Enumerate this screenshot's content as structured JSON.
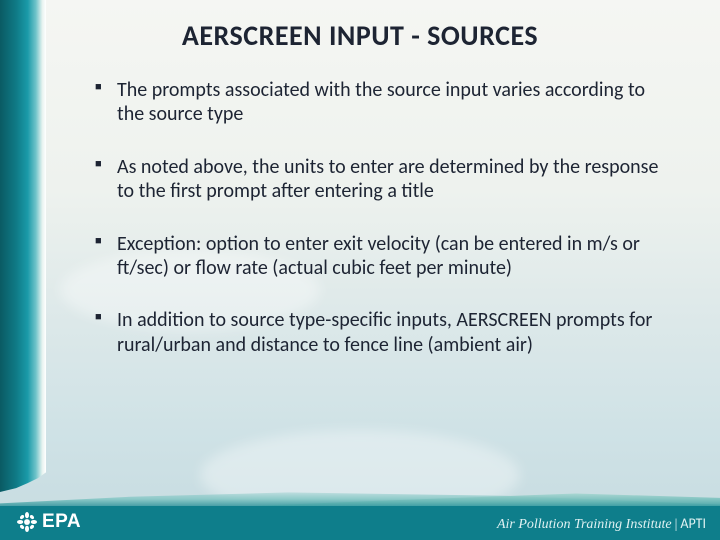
{
  "title": "AERSCREEN INPUT - SOURCES",
  "bullets": [
    "The prompts associated with the source input varies according to the source type",
    "As noted above, the units to enter are determined by the response to the first prompt after entering a title",
    "Exception: option to enter exit velocity (can be entered in m/s or ft/sec) or flow rate (actual cubic feet per minute)",
    "In addition to source type-specific inputs, AERSCREEN prompts for rural/urban and distance to fence line (ambient air)"
  ],
  "footer": {
    "logo_text": "EPA",
    "org_full": "Air Pollution Training Institute",
    "org_abbr": "APTI"
  }
}
